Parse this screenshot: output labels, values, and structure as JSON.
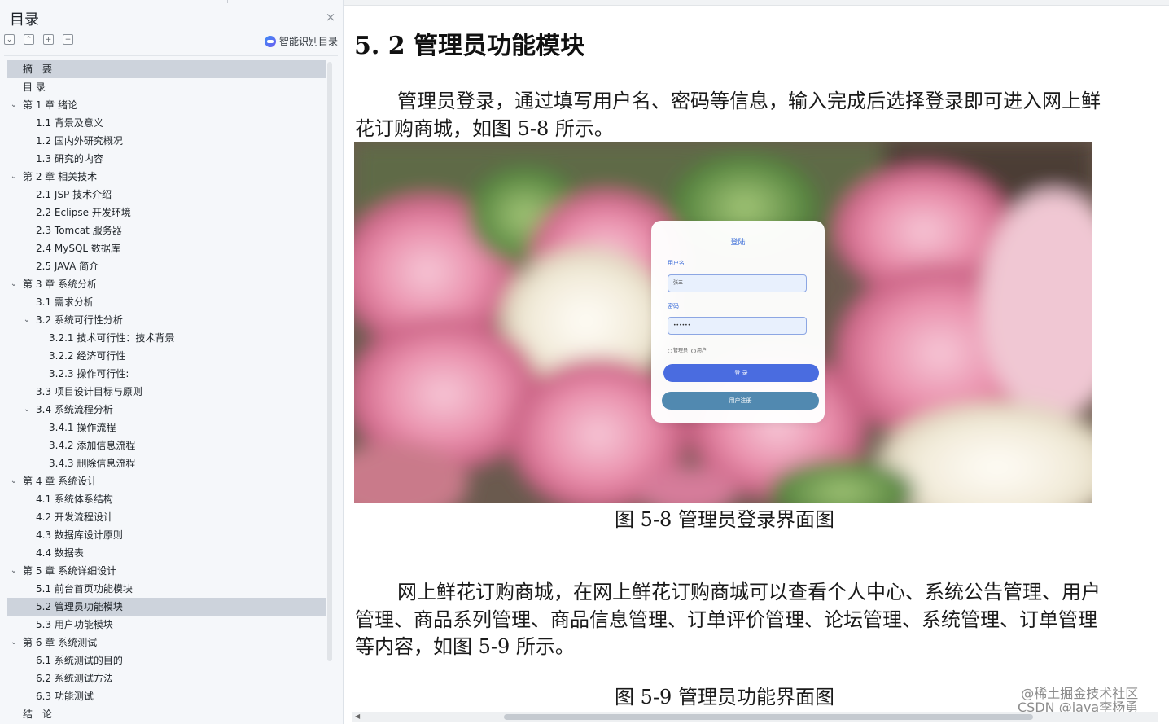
{
  "sidebar": {
    "title": "目录",
    "close_icon": "×",
    "tools": [
      {
        "name": "collapse-all-icon",
        "glyph": "⌄"
      },
      {
        "name": "expand-up-icon",
        "glyph": "⌃"
      },
      {
        "name": "expand-plus-icon",
        "glyph": "+"
      },
      {
        "name": "collapse-minus-icon",
        "glyph": "−"
      }
    ],
    "smart_button_label": "智能识别目录",
    "items": [
      {
        "label": "摘　要",
        "level": 0,
        "chevron": false,
        "active": true
      },
      {
        "label": "目 录",
        "level": 0,
        "chevron": false
      },
      {
        "label": "第 1 章  绪论",
        "level": 0,
        "chevron": true
      },
      {
        "label": "1.1 背景及意义",
        "level": 1,
        "chevron": false
      },
      {
        "label": "1.2  国内外研究概况",
        "level": 1,
        "chevron": false
      },
      {
        "label": "1.3  研究的内容",
        "level": 1,
        "chevron": false
      },
      {
        "label": "第 2 章  相关技术",
        "level": 0,
        "chevron": true
      },
      {
        "label": "2.1 JSP 技术介绍",
        "level": 1,
        "chevron": false
      },
      {
        "label": "2.2 Eclipse 开发环境",
        "level": 1,
        "chevron": false
      },
      {
        "label": "2.3 Tomcat 服务器",
        "level": 1,
        "chevron": false
      },
      {
        "label": "2.4 MySQL 数据库",
        "level": 1,
        "chevron": false
      },
      {
        "label": "2.5 JAVA 简介",
        "level": 1,
        "chevron": false
      },
      {
        "label": "第 3 章  系统分析",
        "level": 0,
        "chevron": true
      },
      {
        "label": "3.1  需求分析",
        "level": 1,
        "chevron": false
      },
      {
        "label": "3.2  系统可行性分析",
        "level": 1,
        "chevron": true
      },
      {
        "label": "3.2.1 技术可行性：技术背景",
        "level": 2,
        "chevron": false
      },
      {
        "label": "3.2.2 经济可行性",
        "level": 2,
        "chevron": false
      },
      {
        "label": "3.2.3 操作可行性:",
        "level": 2,
        "chevron": false
      },
      {
        "label": "3.3  项目设计目标与原则",
        "level": 1,
        "chevron": false
      },
      {
        "label": "3.4 系统流程分析",
        "level": 1,
        "chevron": true
      },
      {
        "label": "3.4.1 操作流程",
        "level": 2,
        "chevron": false
      },
      {
        "label": "3.4.2 添加信息流程",
        "level": 2,
        "chevron": false
      },
      {
        "label": "3.4.3 删除信息流程",
        "level": 2,
        "chevron": false
      },
      {
        "label": "第 4 章  系统设计",
        "level": 0,
        "chevron": true
      },
      {
        "label": "4.1  系统体系结构",
        "level": 1,
        "chevron": false
      },
      {
        "label": "4.2 开发流程设计",
        "level": 1,
        "chevron": false
      },
      {
        "label": "4.3  数据库设计原则",
        "level": 1,
        "chevron": false
      },
      {
        "label": "4.4  数据表",
        "level": 1,
        "chevron": false
      },
      {
        "label": "第 5 章  系统详细设计",
        "level": 0,
        "chevron": true
      },
      {
        "label": "5.1 前台首页功能模块",
        "level": 1,
        "chevron": false
      },
      {
        "label": "5.2 管理员功能模块",
        "level": 1,
        "chevron": false,
        "active": true
      },
      {
        "label": "5.3 用户功能模块",
        "level": 1,
        "chevron": false
      },
      {
        "label": "第 6 章   系统测试",
        "level": 0,
        "chevron": true
      },
      {
        "label": "6.1 系统测试的目的",
        "level": 1,
        "chevron": false
      },
      {
        "label": "6.2 系统测试方法",
        "level": 1,
        "chevron": false
      },
      {
        "label": "6.3 功能测试",
        "level": 1,
        "chevron": false
      },
      {
        "label": "结　论",
        "level": 0,
        "chevron": false
      }
    ]
  },
  "document": {
    "heading": "5. 2 管理员功能模块",
    "para1": "管理员登录，通过填写用户名、密码等信息，输入完成后选择登录即可进入网上鲜花订购商城，如图 5-8 所示。",
    "figure": {
      "login_title": "登陆",
      "username_label": "用户名",
      "username_value": "张三",
      "password_label": "密码",
      "password_value": "••••••",
      "radio_admin": "管理员",
      "radio_user": "用户",
      "login_button": "登 录",
      "register_button": "用户注册"
    },
    "caption1": "图 5-8 管理员登录界面图",
    "para2": "网上鲜花订购商城，在网上鲜花订购商城可以查看个人中心、系统公告管理、用户管理、商品系列管理、商品信息管理、订单评价管理、论坛管理、系统管理、订单管理等内容，如图 5-9 所示。",
    "caption2": "图 5-9 管理员功能界面图"
  },
  "watermark": {
    "line1": "@稀土掘金技术社区",
    "line2": "CSDN @java李杨勇"
  },
  "colors": {
    "sidebar_bg": "#f5f7fa",
    "active_item_bg": "#cdd3dc",
    "login_accent": "#4a6ce0",
    "register_accent": "#5189b0"
  }
}
